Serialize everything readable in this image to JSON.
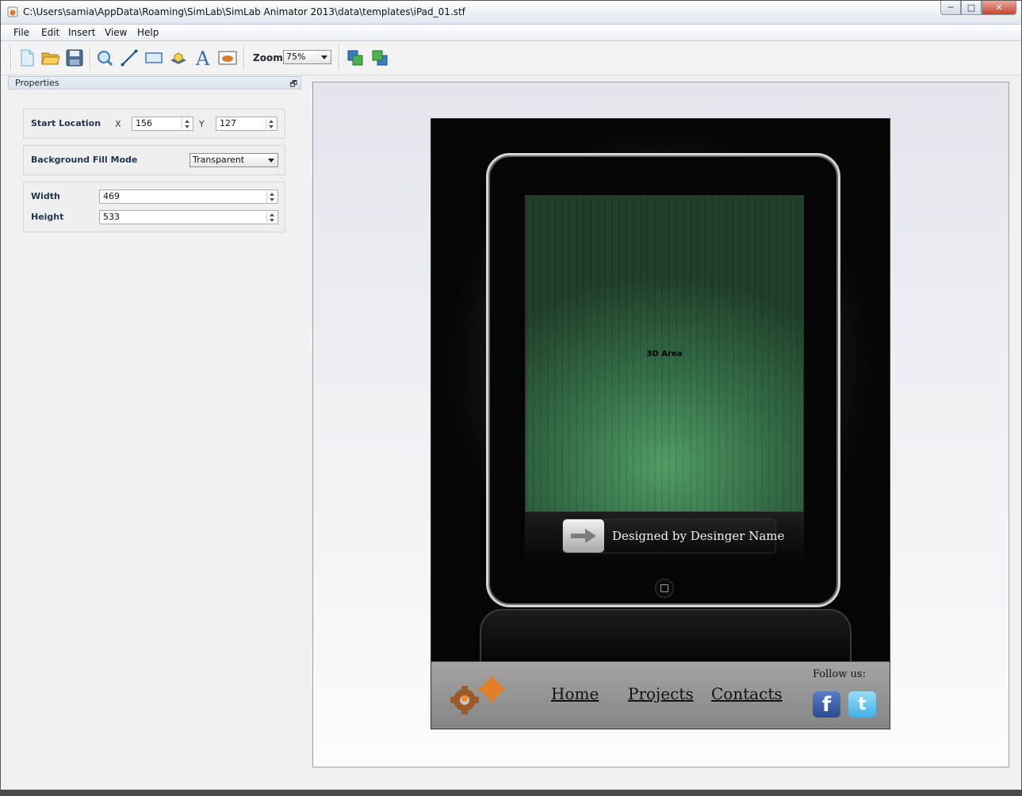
{
  "window": {
    "title": "C:\\Users\\samia\\AppData\\Roaming\\SimLab\\SimLab Animator 2013\\data\\templates\\iPad_01.stf",
    "controls": {
      "minimize": "─",
      "maximize": "□",
      "close": "✕"
    }
  },
  "menu": [
    "File",
    "Edit",
    "Insert",
    "View",
    "Help"
  ],
  "toolbar": {
    "tools": [
      "new-file-icon",
      "open-folder-icon",
      "save-icon",
      "zoom-area-icon",
      "line-tool-icon",
      "rectangle-tool-icon",
      "3d-area-icon",
      "text-tool-icon",
      "image-tool-icon"
    ],
    "zoom_label": "Zoom",
    "zoom_value": "75%",
    "arrange": [
      "bring-forward-icon",
      "send-backward-icon"
    ]
  },
  "properties": {
    "title": "Properties",
    "start_location": {
      "label": "Start Location",
      "x_label": "X",
      "x_value": "156",
      "y_label": "Y",
      "y_value": "127"
    },
    "background_fill": {
      "label": "Background Fill Mode",
      "value": "Transparent"
    },
    "size": {
      "width_label": "Width",
      "width_value": "469",
      "height_label": "Height",
      "height_value": "533"
    }
  },
  "template": {
    "screen_label": "3D Area",
    "designed_by": "Designed by  Desinger Name",
    "nav": [
      "Home",
      "Projects",
      "Contacts"
    ],
    "follow_label": "Follow us:",
    "social": {
      "facebook_glyph": "f",
      "twitter_glyph": "t"
    }
  }
}
